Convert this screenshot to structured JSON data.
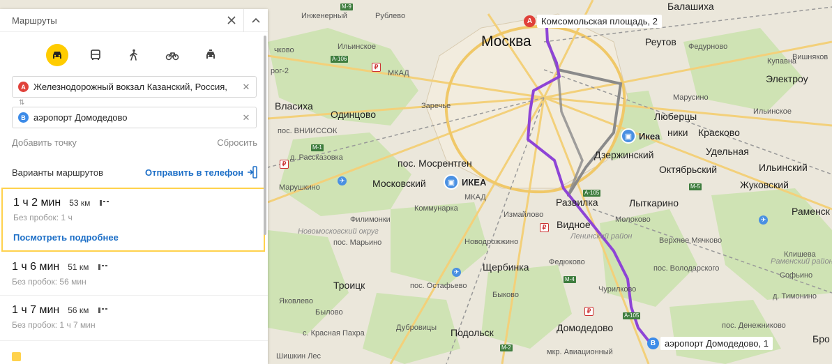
{
  "panel": {
    "title": "Маршруты",
    "from": "Железнодорожный вокзал Казанский, Россия,",
    "to": "аэропорт Домодедово",
    "from_badge": "A",
    "to_badge": "B",
    "add_point": "Добавить точку",
    "reset": "Сбросить",
    "variants_label": "Варианты маршрутов",
    "send_to_phone": "Отправить в телефон",
    "modes": [
      "car",
      "bus",
      "walk",
      "bike",
      "taxi"
    ],
    "active_mode": "car",
    "routes": [
      {
        "time": "1 ч 2 мин",
        "distance": "53 км",
        "no_traffic": "Без пробок: 1 ч",
        "details": "Посмотреть подробнее"
      },
      {
        "time": "1 ч 6 мин",
        "distance": "51 км",
        "no_traffic": "Без пробок: 56 мин"
      },
      {
        "time": "1 ч 7 мин",
        "distance": "56 км",
        "no_traffic": "Без пробок: 1 ч 7 мин"
      }
    ]
  },
  "map": {
    "pin_a": "Комсомольская площадь, 2",
    "pin_b": "аэропорт Домодедово, 1",
    "poi_ikea_1": "ИКЕА",
    "poi_ikea_2": "Икеа",
    "route_color": "#8e44d6",
    "labels": {
      "moskva": "Москва",
      "balashikha": "Балашиха",
      "reutov": "Реутов",
      "lyubertsy": "Люберцы",
      "kraskovo": "Красково",
      "dzerzhinsky": "Дзержинский",
      "udelnaya": "Удельная",
      "oktyabrsky": "Октябрьский",
      "ilyinsky": "Ильинский",
      "zhukovsky": "Жуковский",
      "lytkarino": "Лыткарино",
      "razvilka": "Развилка",
      "vidnoe": "Видное",
      "moskovsky": "Московский",
      "mosrentgen": "пос. Мосрентген",
      "odintsovo": "Одинцово",
      "vlasikha": "Власиха",
      "troitsk": "Троицк",
      "shcherbinka": "Щербинка",
      "domodedovo": "Домодедово",
      "podolsk": "Подольск",
      "marushkino": "Марушкино",
      "kommunarka": "Коммунарка",
      "filimonki": "Филимонки",
      "izmailovo": "Измайлово",
      "novodrozhzhino": "Новодрожжино",
      "marino": "пос. Марьино",
      "ostafyevo": "пос. Остафьево",
      "fedyukovo": "Федюково",
      "chirikovo": "Чурилково",
      "bykovo": "Быково",
      "molokovo": "Молоково",
      "verkhnee_myachkovo": "Верхнее Мячково",
      "volodarsky": "пос. Володарского",
      "sofyino": "Софьино",
      "timonino": "д. Тимонино",
      "denezhnikovo": "пос. Денежниково",
      "aviatsionny": "мкр. Авиационный",
      "ramensk": "Раменск",
      "klishева": "Клишева",
      "elektrou": "Электроу",
      "fedurnovo": "Федурново",
      "maryusino": "Марусино",
      "nikki": "ники",
      "vishnyakovo": "Вишняков",
      "kupavna": "Купавна",
      "ilyinskoe": "Ильинское",
      "ingenerny": "Инженерный",
      "rublevo": "Рублево",
      "zarechye": "Заречье",
      "ramensky_raion": "Раменский район",
      "leninsky_raion": "Ленинский район",
      "novomoskovsky": "Новомосковский округ",
      "yakovlevo": "Яковлево",
      "bylovo": "Былово",
      "dubrovitsy": "Дубровицы",
      "krasnaya_pakhra": "с. Красная Пахра",
      "vniissok": "пос. ВНИИССОК",
      "rasskazovka": "д. Рассказовка",
      "shishkin_les": "Шишкин Лес",
      "mkad": "МКАД",
      "chkovo": "чково",
      "rog2": "рог-2",
      "bro": "Бро"
    },
    "roads": {
      "m1": "М-1",
      "m4": "М-4",
      "m5": "М-5",
      "m9": "М-9",
      "a105": "А-105",
      "a106": "А-106",
      "m2": "М-2",
      "mkad_sign": "МКАД"
    }
  }
}
